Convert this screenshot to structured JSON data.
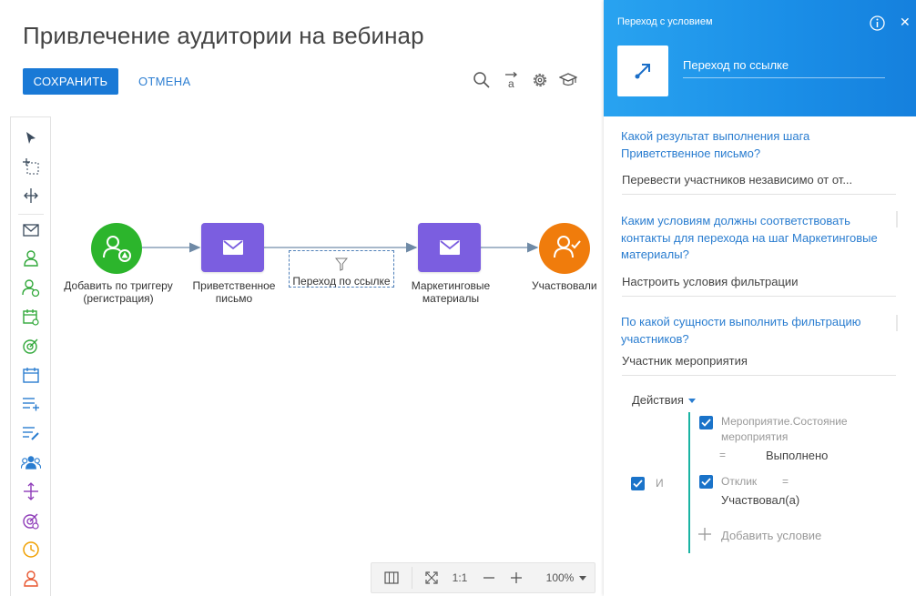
{
  "page": {
    "title": "Привлечение аудитории на вебинар"
  },
  "toolbar": {
    "save_label": "СОХРАНИТЬ",
    "cancel_label": "ОТМЕНА"
  },
  "canvas": {
    "nodes": [
      {
        "label": "Добавить по триггеру (регистрация)",
        "kind": "trigger",
        "color": "#2cb52c"
      },
      {
        "label": "Приветственное письмо",
        "kind": "email",
        "color": "#7b5ee0"
      },
      {
        "label": "Маркетинговые материалы",
        "kind": "email",
        "color": "#7b5ee0"
      },
      {
        "label": "Участвовали",
        "kind": "audience",
        "color": "#f07c0c"
      }
    ],
    "connection_label": "Переход по ссылке"
  },
  "zoom": {
    "ratio_label": "1:1",
    "level": "100%"
  },
  "panel": {
    "header_title": "Переход с условием",
    "element_name": "Переход по ссылке",
    "truncated_q": "",
    "q1": "Какой результат выполнения шага Приветственное письмо?",
    "a1": "Перевести участников независимо от от...",
    "q2": "Каким условиям должны соответствовать контакты для перехода на шаг Маркетинговые материалы?",
    "a2": "Настроить условия фильтрации",
    "q3": "По какой сущности выполнить фильтрацию участников?",
    "a3": "Участник мероприятия",
    "actions_label": "Действия",
    "group_operator": "И",
    "conditions": [
      {
        "field": "Мероприятие.Состояние мероприятия",
        "op": "=",
        "value": "Выполнено"
      },
      {
        "field": "Отклик",
        "op": "=",
        "value": "Участвовал(а)"
      }
    ],
    "add_condition_label": "Добавить условие"
  },
  "colors": {
    "accent": "#1979d6",
    "panel_gradient": "#1a8ee7",
    "email_node": "#7b5ee0",
    "trigger_node": "#2cb52c",
    "audience_node": "#f07c0c",
    "condition_bar": "#1ab3a3"
  }
}
